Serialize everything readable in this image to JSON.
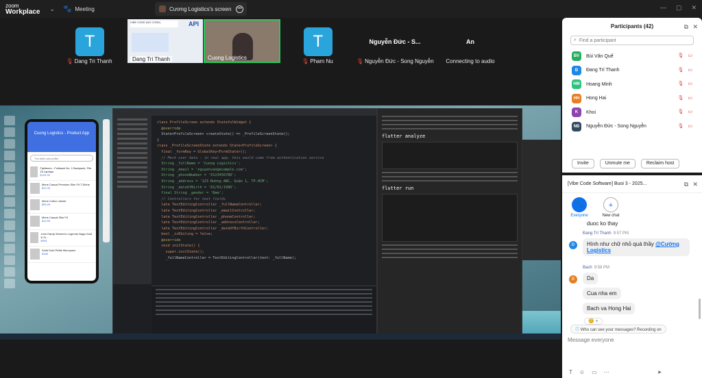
{
  "topbar": {
    "brand_top": "zoom",
    "brand_bottom": "Workplace",
    "meeting_label": "Meeting",
    "share_tab_label": "Cương Logistics's screen"
  },
  "gallery": {
    "tiles": [
      {
        "initial": "T",
        "name": "Dang Tri Thanh"
      },
      {
        "initial": "T",
        "name": "Pham Nu"
      }
    ],
    "video_tiles": [
      {
        "name": "Dang Tri Thanh",
        "banner": "VIBE CODE (NO CODE)",
        "api_text": "API"
      },
      {
        "name": "Cuong Logistics"
      }
    ],
    "name_tiles": [
      {
        "big": "Nguyễn Đức - S...",
        "small": "Nguyễn Đức - Song Nguyễn"
      },
      {
        "big": "An",
        "small": "Connecting to audio"
      }
    ]
  },
  "shared_screen": {
    "phone": {
      "title": "Cuong Logistics - Product App",
      "search_placeholder": "Tìm kiếm sản phẩm",
      "items": [
        {
          "name": "Fjallraven - Foldsack No. 1 Backpack, Fits 15 Laptops",
          "price": "$109.95"
        },
        {
          "name": "Mens Casual Premium Slim Fit T-Shirts",
          "price": "$22.30"
        },
        {
          "name": "Mens Cotton Jacket",
          "price": "$55.99"
        },
        {
          "name": "Mens Casual Slim Fit",
          "price": "$15.99"
        },
        {
          "name": "John Hardy Women's Legends Naga Gold & Si...",
          "price": "$695"
        },
        {
          "name": "Solid Gold Petite Micropave",
          "price": "$168"
        }
      ]
    },
    "code_lines": [
      "class ProfileScreen extends StatefulWidget {",
      "  @override",
      "  State<ProfileScreen> createState() => _ProfileScreenState();",
      "}",
      "",
      "class _ProfileScreenState extends State<ProfileScreen> {",
      "  final _formKey = GlobalKey<FormState>();",
      "",
      "  // Mock user data - in real app, this would come from authentication service",
      "  String _fullName = 'Cuong Logistics';",
      "  String _email = 'nguyenvan@example.com';",
      "  String _phoneNumber = '0123456789';",
      "  String _address = '123 Đường ABC, Quận 1, TP.HCM';",
      "  String _dateOfBirth = '01/01/1990';",
      "  final String _gender = 'Nam';",
      "",
      "  // Controllers for text fields",
      "  late TextEditingController _fullNameController;",
      "  late TextEditingController _emailController;",
      "  late TextEditingController _phoneController;",
      "  late TextEditingController _addressController;",
      "  late TextEditingController _dateOfBirthController;",
      "",
      "  bool _isEditing = false;",
      "",
      "  @override",
      "  void initState() {",
      "    super.initState();",
      "    _fullNameController = TextEditingController(text: _fullName);"
    ],
    "chat_commands": [
      "flutter analyze",
      "flutter run"
    ]
  },
  "participants": {
    "title": "Participants (42)",
    "search_placeholder": "Find a participant",
    "list": [
      {
        "initials": "BV",
        "name": "Bùi Văn Quế",
        "color": "#27ae60",
        "icons": "mic-off video-off"
      },
      {
        "initials": "Đ",
        "name": "Đang Trí Thanh",
        "color": "#1e88e5",
        "icons": "mic-off video-off"
      },
      {
        "initials": "HM",
        "name": "Hoang Minh",
        "color": "#2ec27e",
        "icons": "mic-off video-off"
      },
      {
        "initials": "HH",
        "name": "Hong Hai",
        "color": "#e67e22",
        "icons": "mic-off video-off"
      },
      {
        "initials": "K",
        "name": "Khoi",
        "color": "#8e44ad",
        "icons": "mic-off video-off"
      },
      {
        "initials": "NĐ",
        "name": "Nguyễn Đức - Song Nguyễn",
        "color": "#34495e",
        "icons": "mic-off video-off"
      }
    ],
    "buttons": {
      "invite": "Invite",
      "unmute_me": "Unmute me",
      "reclaim_host": "Reclaim host"
    }
  },
  "chat": {
    "title": "[Vibe Code Software] Buoi 3 - 2025...",
    "tabs": [
      {
        "label": "Everyone"
      },
      {
        "label": "New chat"
      }
    ],
    "messages": [
      {
        "text": "duoc ko thay"
      },
      {
        "sender": "Đang Trí Thanh",
        "time": "9:57 PM",
        "initial": "Đ",
        "text_prefix": "Hình như chữ nhỏ quá thầy ",
        "mention": "@Cường Logistics"
      },
      {
        "sender": "Bach",
        "time": "9:58 PM",
        "initial": "B",
        "text": "Da"
      },
      {
        "text": "Cua nha em"
      },
      {
        "text": "Bach va Hong Hai"
      }
    ],
    "reaction": "😊",
    "notice_text": "Who can see your messages? Recording on",
    "compose_placeholder": "Message everyone"
  },
  "colors": {
    "zoom_blue": "#0e71eb",
    "avatar_blue": "#2aa5dc",
    "active_speaker": "#27c85a",
    "muted_red": "#e03c3c"
  }
}
